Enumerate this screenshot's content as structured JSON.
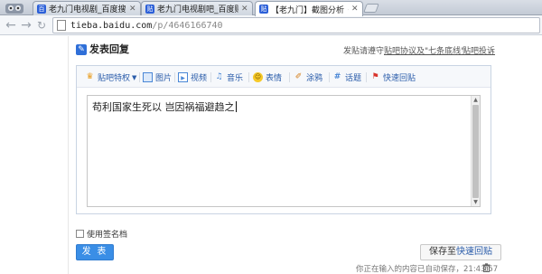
{
  "browser": {
    "tabs": [
      {
        "title": "老九门电视剧_百度搜索",
        "active": false
      },
      {
        "title": "老九门电视剧吧_百度贴吧",
        "active": false
      },
      {
        "title": "【老九门】截图分析《老九",
        "active": true
      }
    ],
    "url_host": "tieba.baidu.com",
    "url_path": "/p/4646166740"
  },
  "post": {
    "title": "发表回复",
    "notice_prefix": "发贴请遵守",
    "notice_link": "贴吧协议及\"七条底线\"",
    "report_link": "贴吧投诉"
  },
  "editor": {
    "tools": {
      "privilege": "贴吧特权",
      "image": "图片",
      "video": "视频",
      "music": "音乐",
      "emoji": "表情",
      "graffiti": "涂鸦",
      "topic": "话题",
      "quick_reply": "快速回贴"
    },
    "content": "苟利国家生死以 岂因祸福避趋之"
  },
  "footer": {
    "signature_label": "使用签名档",
    "submit_label": "发 表",
    "save_prefix": "保存至",
    "save_link": "快速回贴",
    "autosave_text": "你正在输入的内容已自动保存，21:43:57"
  },
  "colors": {
    "link": "#2a5caa",
    "submit": "#3a8ee6"
  }
}
